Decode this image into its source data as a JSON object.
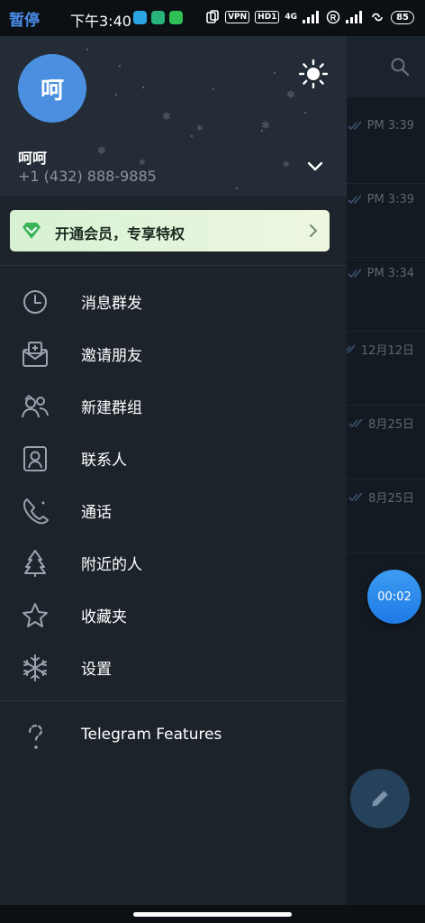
{
  "status_bar": {
    "pause_label": "暂停",
    "time": "下午3:40",
    "app_icons": [
      "telegram-icon",
      "shield-app-icon",
      "phone-app-icon"
    ],
    "vpn": "VPN",
    "hd": "HD1",
    "network": "4G",
    "battery": "85"
  },
  "drawer": {
    "avatar_initial": "呵",
    "user_name": "呵呵",
    "phone": "+1 (432) 888-9885",
    "premium_banner": "开通会员，专享特权",
    "menu": [
      {
        "label": "消息群发",
        "icon": "clock-icon"
      },
      {
        "label": "邀请朋友",
        "icon": "invite-envelope-icon"
      },
      {
        "label": "新建群组",
        "icon": "group-icon"
      },
      {
        "label": "联系人",
        "icon": "contact-card-icon"
      },
      {
        "label": "通话",
        "icon": "phone-call-icon"
      },
      {
        "label": "附近的人",
        "icon": "tree-icon"
      },
      {
        "label": "收藏夹",
        "icon": "star-icon"
      },
      {
        "label": "设置",
        "icon": "snowflake-settings-icon"
      }
    ],
    "features_label": "Telegram Features"
  },
  "background_list": {
    "times": [
      "PM 3:39",
      "PM 3:39",
      "PM 3:34",
      "12月12日",
      "8月25日",
      "8月25日"
    ],
    "timer_fab": "00:02"
  },
  "colors": {
    "accent": "#4a8fe0",
    "drawer_bg": "#1d232b",
    "premium_bg": "#d7f1d2",
    "premium_gem": "#3bb55a"
  }
}
